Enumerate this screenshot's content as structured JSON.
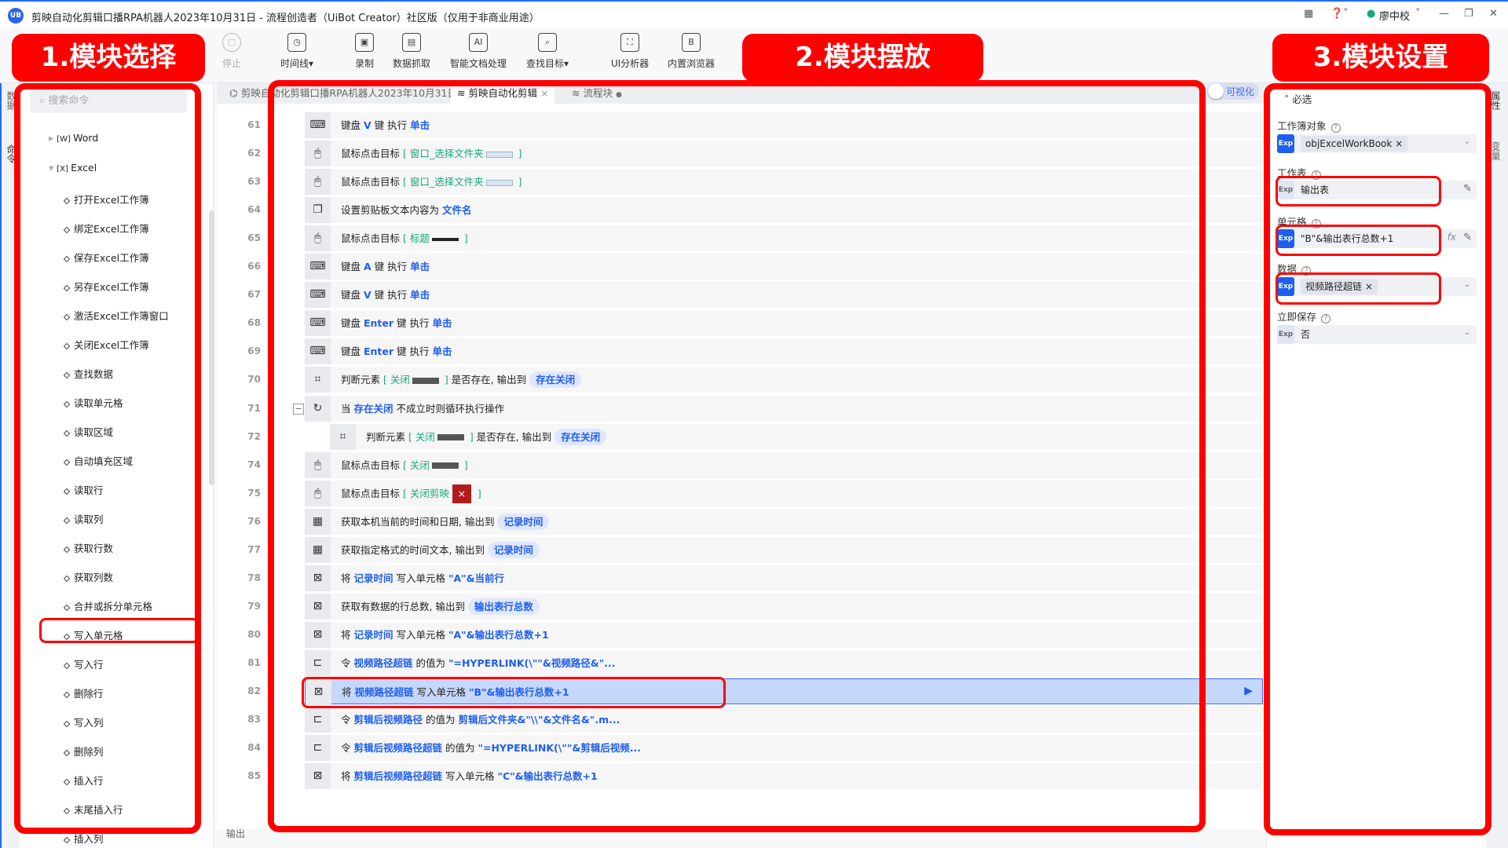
{
  "window": {
    "title": "剪映自动化剪辑口播RPA机器人2023年10月31日 - 流程创造者（UiBot Creator）社区版（仅用于非商业用途）",
    "logo": "UB",
    "user": "廖中校",
    "controls": [
      "apps-icon",
      "help-icon",
      "minimize-icon",
      "maximize-icon",
      "close-icon"
    ]
  },
  "toolbar": [
    {
      "label": "停止",
      "icon": "stop-icon",
      "disabled": true
    },
    {
      "label": "时间线▾",
      "icon": "clock-icon"
    },
    {
      "label": "录制",
      "icon": "record-icon"
    },
    {
      "label": "数据抓取",
      "icon": "data-scrape-icon"
    },
    {
      "label": "智能文档处理",
      "icon": "ai-doc-icon"
    },
    {
      "label": "查找目标▾",
      "icon": "find-target-icon"
    },
    {
      "label": "UI分析器",
      "icon": "ui-analyzer-icon"
    },
    {
      "label": "内置浏览器",
      "icon": "browser-icon"
    }
  ],
  "left_rail": [
    "数据",
    "命令"
  ],
  "left_panel": {
    "search_placeholder": "搜索命令",
    "groups": [
      {
        "label": "Word",
        "expanded": false
      },
      {
        "label": "Excel",
        "expanded": true
      }
    ],
    "items": [
      "打开Excel工作簿",
      "绑定Excel工作簿",
      "保存Excel工作簿",
      "另存Excel工作簿",
      "激活Excel工作簿窗口",
      "关闭Excel工作簿",
      "查找数据",
      "读取单元格",
      "读取区域",
      "自动填充区域",
      "读取行",
      "读取列",
      "获取行数",
      "获取列数",
      "合并或拆分单元格",
      "写入单元格",
      "写入行",
      "删除行",
      "写入列",
      "删除列",
      "插入行",
      "末尾插入行",
      "插入列"
    ],
    "selected": "写入单元格"
  },
  "tabs": [
    {
      "label": "剪映自动化剪辑口播RPA机器人2023年10月31日",
      "icon": "flowchart-icon"
    },
    {
      "label": "剪映自动化剪辑",
      "icon": "layers-icon",
      "active": true,
      "close": "×"
    },
    {
      "label": "流程块",
      "icon": "layers-icon",
      "dot": "●"
    }
  ],
  "visual_toggle": {
    "label": "可视化",
    "on": false
  },
  "rows": [
    {
      "n": "61",
      "icon": "keyboard",
      "seg": [
        [
          "键盘 ",
          ""
        ],
        [
          "V",
          "kw"
        ],
        [
          " 键 执行 ",
          ""
        ],
        [
          "单击",
          "kw"
        ]
      ]
    },
    {
      "n": "62",
      "icon": "mouse",
      "seg": [
        [
          "鼠标点击目标 ",
          ""
        ],
        [
          "[ 窗口_选择文件夹",
          "tgt"
        ],
        [
          "",
          "thumb light"
        ],
        [
          " ]",
          "tgt"
        ]
      ]
    },
    {
      "n": "63",
      "icon": "mouse",
      "seg": [
        [
          "鼠标点击目标 ",
          ""
        ],
        [
          "[ 窗口_选择文件夹",
          "tgt"
        ],
        [
          "",
          "thumb light"
        ],
        [
          " ]",
          "tgt"
        ]
      ]
    },
    {
      "n": "64",
      "icon": "clipboard",
      "seg": [
        [
          "设置剪贴板文本内容为 ",
          ""
        ],
        [
          "文件名",
          "kw"
        ]
      ]
    },
    {
      "n": "65",
      "icon": "mouse",
      "seg": [
        [
          "鼠标点击目标 ",
          ""
        ],
        [
          "[ 标题",
          "tgt"
        ],
        [
          "",
          "thumb dark"
        ],
        [
          " ]",
          "tgt"
        ]
      ]
    },
    {
      "n": "66",
      "icon": "keyboard",
      "seg": [
        [
          "键盘 ",
          ""
        ],
        [
          "A",
          "kw"
        ],
        [
          " 键 执行 ",
          ""
        ],
        [
          "单击",
          "kw"
        ]
      ]
    },
    {
      "n": "67",
      "icon": "keyboard",
      "seg": [
        [
          "键盘 ",
          ""
        ],
        [
          "V",
          "kw"
        ],
        [
          " 键 执行 ",
          ""
        ],
        [
          "单击",
          "kw"
        ]
      ]
    },
    {
      "n": "68",
      "icon": "keyboard",
      "seg": [
        [
          "键盘 ",
          ""
        ],
        [
          "Enter",
          "kw"
        ],
        [
          " 键 执行 ",
          ""
        ],
        [
          "单击",
          "kw"
        ]
      ]
    },
    {
      "n": "69",
      "icon": "keyboard",
      "seg": [
        [
          "键盘 ",
          ""
        ],
        [
          "Enter",
          "kw"
        ],
        [
          " 键 执行 ",
          ""
        ],
        [
          "单击",
          "kw"
        ]
      ]
    },
    {
      "n": "70",
      "icon": "element",
      "seg": [
        [
          "判断元素 ",
          ""
        ],
        [
          "[ 关闭",
          "tgt"
        ],
        [
          "",
          "thumb"
        ],
        [
          " ]",
          "tgt"
        ],
        [
          " 是否存在, 输出到 ",
          ""
        ],
        [
          "存在关闭",
          "pill"
        ]
      ]
    },
    {
      "n": "71",
      "icon": "loop",
      "collapse": "−",
      "seg": [
        [
          "当 ",
          ""
        ],
        [
          "存在关闭",
          "kw"
        ],
        [
          " 不成立时则循环执行操作",
          ""
        ]
      ]
    },
    {
      "n": "72",
      "icon": "element",
      "indent": true,
      "seg": [
        [
          "判断元素 ",
          ""
        ],
        [
          "[ 关闭",
          "tgt"
        ],
        [
          "",
          "thumb"
        ],
        [
          " ]",
          "tgt"
        ],
        [
          " 是否存在, 输出到 ",
          ""
        ],
        [
          "存在关闭",
          "pill"
        ]
      ]
    },
    {
      "n": "74",
      "icon": "mouse",
      "seg": [
        [
          "鼠标点击目标 ",
          ""
        ],
        [
          "[ 关闭",
          "tgt"
        ],
        [
          "",
          "thumb"
        ],
        [
          " ]",
          "tgt"
        ]
      ]
    },
    {
      "n": "75",
      "icon": "mouse",
      "seg": [
        [
          "鼠标点击目标 ",
          ""
        ],
        [
          "[ 关闭剪映",
          "tgt"
        ],
        [
          "×",
          "close"
        ],
        [
          " ]",
          "tgt"
        ]
      ]
    },
    {
      "n": "76",
      "icon": "calendar",
      "seg": [
        [
          "获取本机当前的时间和日期, 输出到 ",
          ""
        ],
        [
          "记录时间",
          "pill"
        ]
      ]
    },
    {
      "n": "77",
      "icon": "calendar",
      "seg": [
        [
          "获取指定格式的时间文本, 输出到 ",
          ""
        ],
        [
          "记录时间",
          "pill"
        ]
      ]
    },
    {
      "n": "78",
      "icon": "excel",
      "seg": [
        [
          "将 ",
          ""
        ],
        [
          "记录时间",
          "kw"
        ],
        [
          " 写入单元格 ",
          ""
        ],
        [
          "\"A\"&当前行",
          "kw"
        ]
      ]
    },
    {
      "n": "79",
      "icon": "excel",
      "seg": [
        [
          "获取有数据的行总数, 输出到 ",
          ""
        ],
        [
          "输出表行总数",
          "pill"
        ]
      ]
    },
    {
      "n": "80",
      "icon": "excel",
      "seg": [
        [
          "将 ",
          ""
        ],
        [
          "记录时间",
          "kw"
        ],
        [
          " 写入单元格 ",
          ""
        ],
        [
          "\"A\"&输出表行总数+1",
          "kw"
        ]
      ]
    },
    {
      "n": "81",
      "icon": "assign",
      "seg": [
        [
          "令 ",
          ""
        ],
        [
          "视频路径超链",
          "kw"
        ],
        [
          " 的值为 ",
          ""
        ],
        [
          "\"=HYPERLINK(\\\"\"&视频路径&\"...",
          "kw"
        ]
      ]
    },
    {
      "n": "82",
      "icon": "excel",
      "selected": true,
      "seg": [
        [
          "将 ",
          ""
        ],
        [
          "视频路径超链",
          "kw"
        ],
        [
          " 写入单元格 ",
          ""
        ],
        [
          "\"B\"&输出表行总数+1",
          "kw"
        ]
      ]
    },
    {
      "n": "83",
      "icon": "assign",
      "seg": [
        [
          "令 ",
          ""
        ],
        [
          "剪辑后视频路径",
          "kw"
        ],
        [
          " 的值为 ",
          ""
        ],
        [
          "剪辑后文件夹&\"\\\\\"&文件名&\".m...",
          "kw"
        ]
      ]
    },
    {
      "n": "84",
      "icon": "assign",
      "seg": [
        [
          "令 ",
          ""
        ],
        [
          "剪辑后视频路径超链",
          "kw"
        ],
        [
          " 的值为 ",
          ""
        ],
        [
          "\"=HYPERLINK(\\\"\"&剪辑后视频...",
          "kw"
        ]
      ]
    },
    {
      "n": "85",
      "icon": "excel",
      "seg": [
        [
          "将 ",
          ""
        ],
        [
          "剪辑后视频路径超链",
          "kw"
        ],
        [
          " 写入单元格 ",
          ""
        ],
        [
          "\"C\"&输出表行总数+1",
          "kw"
        ]
      ]
    }
  ],
  "output_label": "输出",
  "right_panel": {
    "section": "必选",
    "fields": [
      {
        "label": "工作簿对象",
        "exp": "Exp",
        "chip": "objExcelWorkBook",
        "control": "dropdown"
      },
      {
        "label": "工作表",
        "exp": "Exp",
        "value": "输出表",
        "control": "edit",
        "exp_light": true
      },
      {
        "label": "单元格",
        "exp": "Exp",
        "value": "\"B\"&输出表行总数+1",
        "control": "fx-edit"
      },
      {
        "label": "数据",
        "exp": "Exp",
        "chip": "视频路径超链",
        "control": "dropdown"
      },
      {
        "label": "立即保存",
        "exp": "Exp",
        "value": "否",
        "control": "dropdown",
        "exp_light": true
      }
    ]
  },
  "right_rail": [
    "属性",
    "变量"
  ],
  "annotations": {
    "label1": "1.模块选择",
    "label2": "2.模块摆放",
    "label3": "3.模块设置",
    "color": "#ff0000"
  }
}
